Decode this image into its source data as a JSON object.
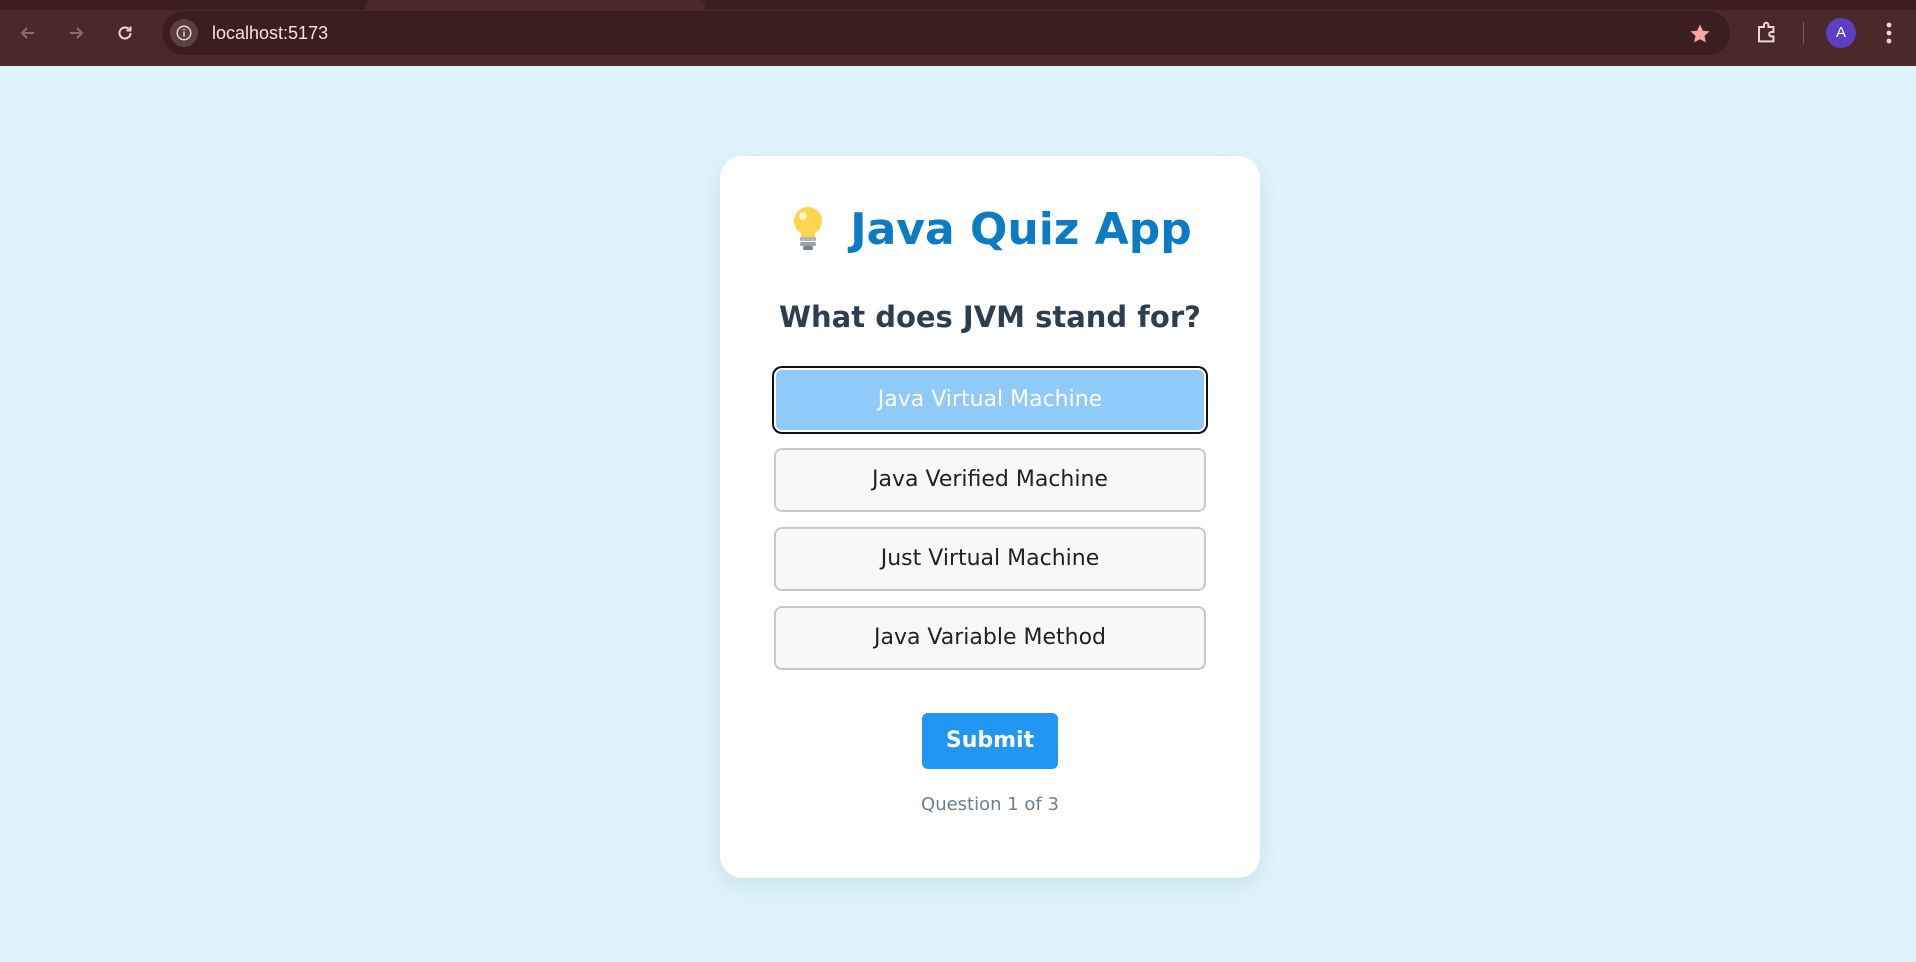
{
  "browser": {
    "url": "localhost:5173",
    "profile_initial": "A",
    "icons": {
      "back": "back-arrow-icon",
      "forward": "forward-arrow-icon",
      "reload": "reload-icon",
      "site_info": "info-icon",
      "bookmark": "star-icon",
      "extensions": "puzzle-icon",
      "menu": "kebab-menu-icon"
    },
    "colors": {
      "frame": "#4a2a28",
      "omnibox": "#3a1f1e",
      "star": "#f4a6a0",
      "avatar": "#5b3fc4"
    }
  },
  "quiz": {
    "title": "Java Quiz App",
    "title_icon": "lightbulb-icon",
    "question": "What does JVM stand for?",
    "options": [
      {
        "label": "Java Virtual Machine",
        "selected": true
      },
      {
        "label": "Java Verified Machine",
        "selected": false
      },
      {
        "label": "Just Virtual Machine",
        "selected": false
      },
      {
        "label": "Java Variable Method",
        "selected": false
      }
    ],
    "submit_label": "Submit",
    "progress_text": "Question 1 of 3"
  },
  "colors": {
    "page_background": "#e0f5fb",
    "title": "#0b7bc4",
    "selected_option": "#90caf9",
    "submit": "#2196f3"
  }
}
